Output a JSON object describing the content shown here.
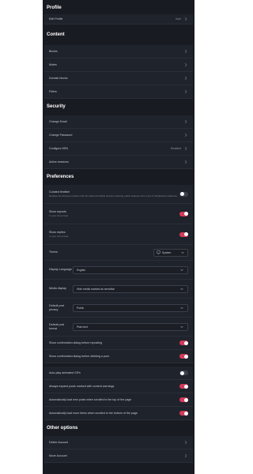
{
  "profile": {
    "title": "Profile",
    "edit_profile": {
      "label": "Edit Profile",
      "value": "User"
    }
  },
  "content": {
    "title": "Content",
    "items": [
      {
        "label": "Blocks"
      },
      {
        "label": "Mutes"
      },
      {
        "label": "Domain blocks"
      },
      {
        "label": "Filters"
      }
    ]
  },
  "security": {
    "title": "Security",
    "items": [
      {
        "label": "Change Email",
        "value": ""
      },
      {
        "label": "Change Password",
        "value": ""
      },
      {
        "label": "Configure MFA",
        "value": "Disabled"
      },
      {
        "label": "Active sessions",
        "value": ""
      }
    ]
  },
  "preferences": {
    "title": "Preferences",
    "curated_timeline": {
      "label": "Curated timeline",
      "hint": "Replace the firehose timeline with the Akkoma bubble timeline showing public statuses from a list of handpicked instances.",
      "on": false
    },
    "show_reposts": {
      "label": "Show reposts",
      "hint": "In your home feed",
      "on": true
    },
    "show_replies": {
      "label": "Show replies",
      "hint": "In your home feed",
      "on": true
    },
    "theme": {
      "label": "Theme",
      "value": "System"
    },
    "display_language": {
      "label": "Display Language",
      "value": "English"
    },
    "media_display": {
      "label": "Media display",
      "value": "Hide media marked as sensitive"
    },
    "default_post_privacy": {
      "label": "Default post privacy",
      "value": "Public"
    },
    "default_post_format": {
      "label": "Default post format",
      "value": "Plain text"
    },
    "confirm_reposting": {
      "label": "Show confirmation dialog before reposting",
      "on": true
    },
    "confirm_deleting": {
      "label": "Show confirmation dialog before deleting a post",
      "on": true
    },
    "autoplay_gifs": {
      "label": "Auto-play animated GIFs",
      "on": false
    },
    "expand_cw": {
      "label": "Always expand posts marked with content warnings",
      "on": true
    },
    "autoload_top": {
      "label": "Automatically load new posts when scrolled to the top of the page",
      "on": true
    },
    "autoload_bottom": {
      "label": "Automatically load more items when scrolled to the bottom of the page",
      "on": true
    }
  },
  "other": {
    "title": "Other options",
    "items": [
      {
        "label": "Delete Account"
      },
      {
        "label": "Move Account"
      }
    ]
  },
  "colors": {
    "background": "#191b22",
    "row": "#1f232b",
    "accent": "#d23a5a",
    "toggle_off": "#3a3f4b"
  },
  "icons": {
    "chevron": "chevron-right-icon",
    "dropdown": "chevron-down-icon",
    "theme": "monitor-icon"
  }
}
